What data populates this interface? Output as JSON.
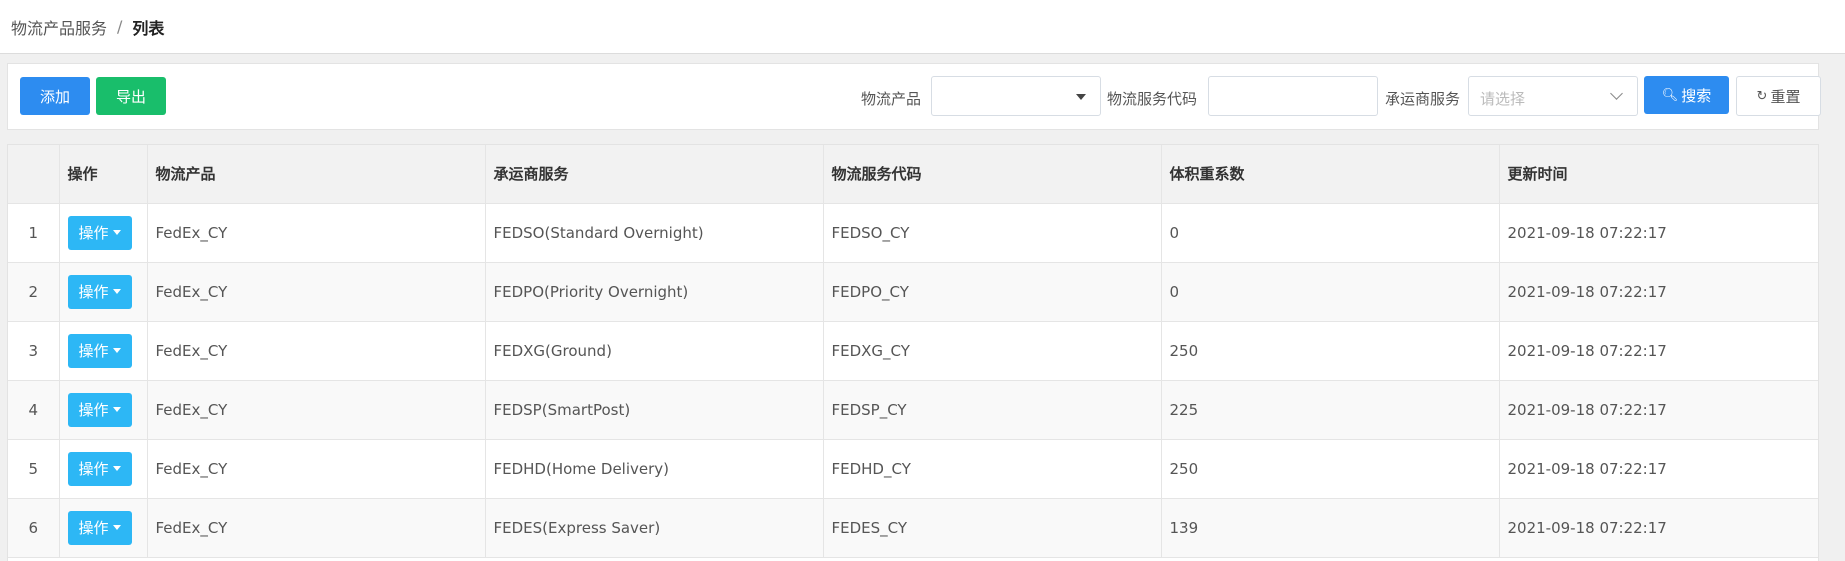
{
  "breadcrumb": {
    "root": "物流产品服务",
    "separator": "/",
    "current": "列表"
  },
  "toolbar": {
    "add_label": "添加",
    "export_label": "导出",
    "product_label": "物流产品",
    "product_value": "",
    "service_code_label": "物流服务代码",
    "service_code_value": "",
    "carrier_label": "承运商服务",
    "carrier_placeholder": "请选择",
    "search_label": "搜索",
    "reset_label": "重置"
  },
  "table": {
    "columns": [
      "",
      "操作",
      "物流产品",
      "承运商服务",
      "物流服务代码",
      "体积重系数",
      "更新时间"
    ],
    "action_label": "操作",
    "rows": [
      {
        "index": "1",
        "product": "FedEx_CY",
        "carrier_service": "FEDSO(Standard Overnight)",
        "service_code": "FEDSO_CY",
        "vol_factor": "0",
        "updated": "2021-09-18 07:22:17"
      },
      {
        "index": "2",
        "product": "FedEx_CY",
        "carrier_service": "FEDPO(Priority Overnight)",
        "service_code": "FEDPO_CY",
        "vol_factor": "0",
        "updated": "2021-09-18 07:22:17"
      },
      {
        "index": "3",
        "product": "FedEx_CY",
        "carrier_service": "FEDXG(Ground)",
        "service_code": "FEDXG_CY",
        "vol_factor": "250",
        "updated": "2021-09-18 07:22:17"
      },
      {
        "index": "4",
        "product": "FedEx_CY",
        "carrier_service": "FEDSP(SmartPost)",
        "service_code": "FEDSP_CY",
        "vol_factor": "225",
        "updated": "2021-09-18 07:22:17"
      },
      {
        "index": "5",
        "product": "FedEx_CY",
        "carrier_service": "FEDHD(Home Delivery)",
        "service_code": "FEDHD_CY",
        "vol_factor": "250",
        "updated": "2021-09-18 07:22:17"
      },
      {
        "index": "6",
        "product": "FedEx_CY",
        "carrier_service": "FEDES(Express Saver)",
        "service_code": "FEDES_CY",
        "vol_factor": "139",
        "updated": "2021-09-18 07:22:17"
      }
    ]
  },
  "colors": {
    "primary": "#2d8cf0",
    "success": "#19be6b",
    "info": "#2db7f5"
  }
}
